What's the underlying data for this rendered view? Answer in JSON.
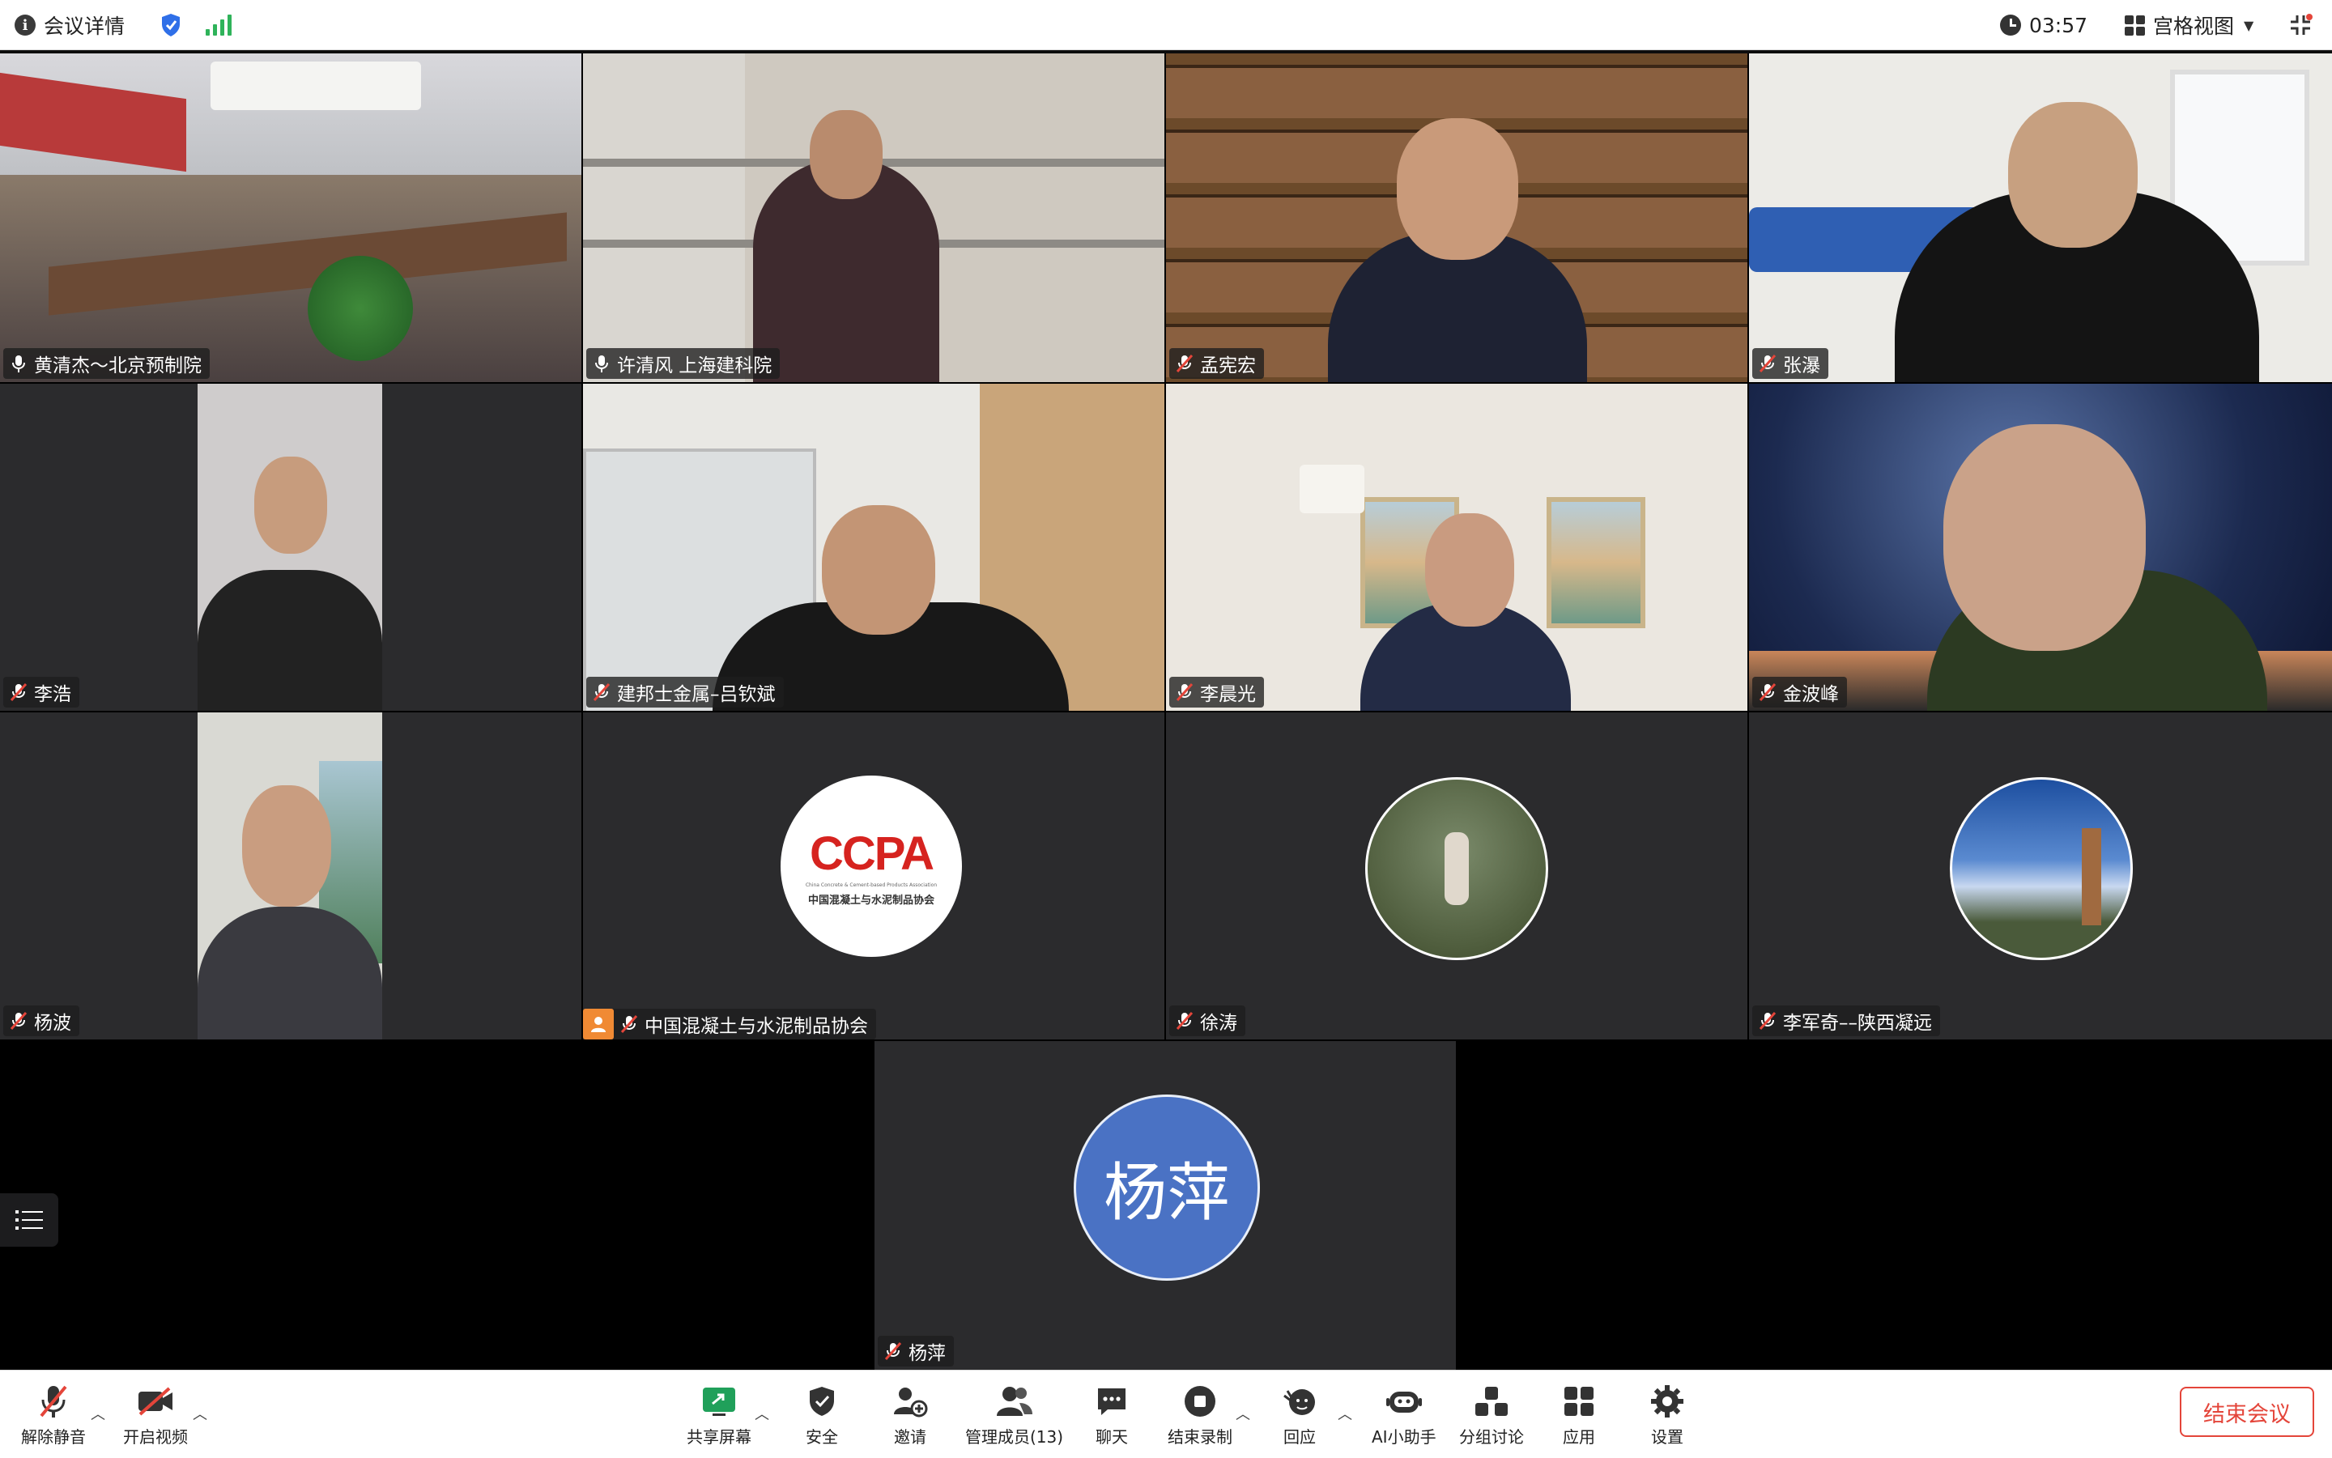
{
  "topbar": {
    "meeting_info": "会议详情",
    "timer": "03:57",
    "view_mode": "宫格视图"
  },
  "participants": [
    {
      "name": "黄清杰～北京预制院",
      "muted": false
    },
    {
      "name": "许清风 上海建科院",
      "muted": false
    },
    {
      "name": "孟宪宏",
      "muted": true
    },
    {
      "name": "张瀑",
      "muted": true
    },
    {
      "name": "李浩",
      "muted": true
    },
    {
      "name": "建邦士金属–吕钦斌",
      "muted": true
    },
    {
      "name": "李晨光",
      "muted": true
    },
    {
      "name": "金波峰",
      "muted": true
    },
    {
      "name": "杨波",
      "muted": true
    },
    {
      "name": "中国混凝土与水泥制品协会",
      "muted": true
    },
    {
      "name": "徐涛",
      "muted": true
    },
    {
      "name": "李军奇––陕西凝远",
      "muted": true
    },
    {
      "name": "杨萍",
      "muted": true
    }
  ],
  "ccpa_logo": {
    "abbr": "CCPA",
    "en": "China Concrete & Cement-based Products Association",
    "cn": "中国混凝土与水泥制品协会"
  },
  "avatar_initials": "杨萍",
  "toolbar": {
    "unmute": "解除静音",
    "start_video": "开启视频",
    "share_screen": "共享屏幕",
    "security": "安全",
    "invite": "邀请",
    "manage_members": "管理成员(13)",
    "chat": "聊天",
    "end_recording": "结束录制",
    "reactions": "回应",
    "ai_assistant": "AI小助手",
    "breakout": "分组讨论",
    "apps": "应用",
    "settings": "设置",
    "end_meeting": "结束会议"
  },
  "colors": {
    "active_speaker": "#41c65d",
    "end_button": "#e4453a",
    "avatar_bg": "#4a72c4",
    "signal": "#2fb35a"
  }
}
